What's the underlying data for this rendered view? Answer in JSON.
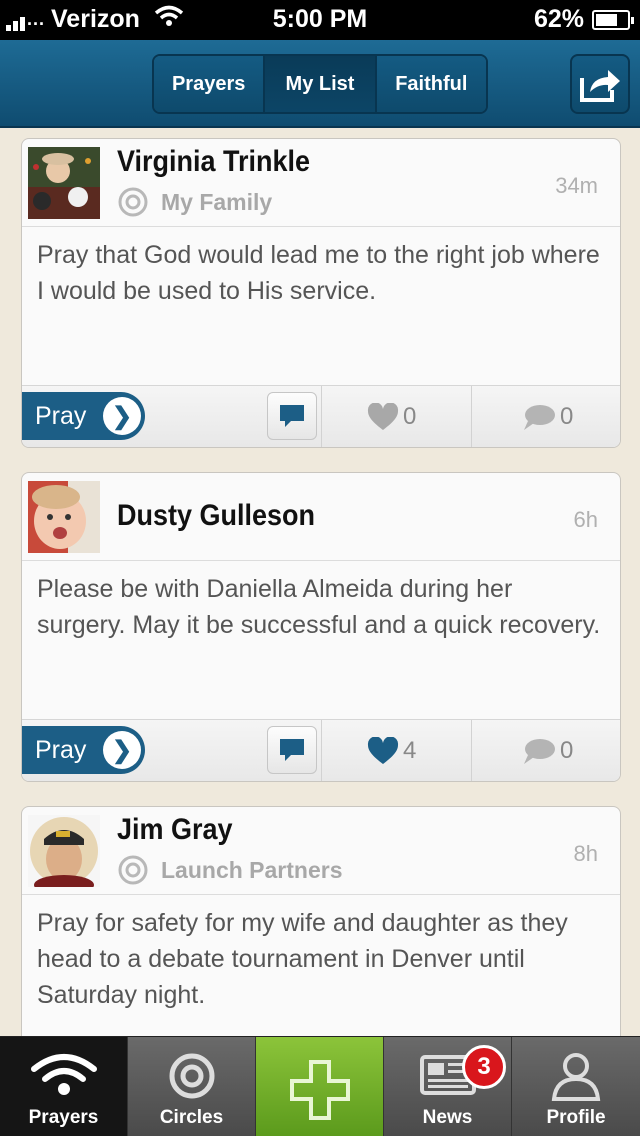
{
  "status_bar": {
    "carrier": "Verizon",
    "time": "5:00 PM",
    "battery": "62%",
    "battery_level": 0.62
  },
  "nav": {
    "tabs": [
      {
        "label": "Prayers",
        "active": false
      },
      {
        "label": "My List",
        "active": true
      },
      {
        "label": "Faithful",
        "active": false
      }
    ],
    "share_icon": "share-icon"
  },
  "posts": [
    {
      "name": "Virginia Trinkle",
      "circle": "My Family",
      "time": "34m",
      "text": "Pray that God would lead me to the right job where I would be used to His service.",
      "pray_label": "Pray",
      "likes": "0",
      "comments": "0",
      "liked": false
    },
    {
      "name": "Dusty Gulleson",
      "circle": "",
      "time": "6h",
      "text": "Please be with Daniella Almeida during her surgery. May it be successful and a quick recovery.",
      "pray_label": "Pray",
      "likes": "4",
      "comments": "0",
      "liked": true
    },
    {
      "name": "Jim Gray",
      "circle": "Launch Partners",
      "time": "8h",
      "text": "Pray for safety for my wife and daughter as they head to a debate tournament in Denver until Saturday night."
    }
  ],
  "tabbar": {
    "items": [
      {
        "label": "Prayers",
        "icon": "wifi-icon",
        "active": true
      },
      {
        "label": "Circles",
        "icon": "target-icon"
      },
      {
        "label": "",
        "icon": "plus-icon"
      },
      {
        "label": "News",
        "icon": "newspaper-icon",
        "badge": "3"
      },
      {
        "label": "Profile",
        "icon": "person-icon"
      }
    ]
  },
  "colors": {
    "nav_blue": "#145b83",
    "accent_green": "#7ab42c",
    "badge_red": "#d9161c"
  }
}
